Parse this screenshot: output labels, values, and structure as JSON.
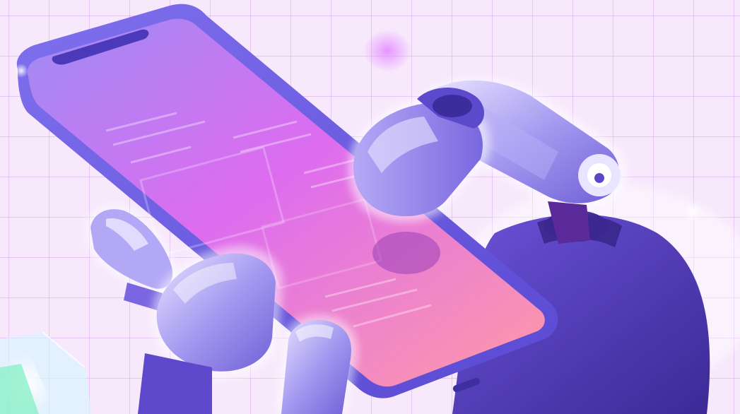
{
  "scene": {
    "description_kind": "illustration",
    "subject": "robot-hand-holding-smartphone",
    "colors": {
      "background": "#f7e8fc",
      "grid": "#d8aaec",
      "phone_frame": "#6a5ae6",
      "screen_top": "#9a86f2",
      "screen_mid": "#e36cf0",
      "screen_bottom": "#ff8fb0",
      "robot_light": "#c9c2f6",
      "robot_mid": "#8f82ea",
      "robot_dark": "#5a45c8",
      "robot_shadow": "#3f2c9c",
      "glow": "#ffffff",
      "accent_green": "#7df0c0"
    }
  }
}
